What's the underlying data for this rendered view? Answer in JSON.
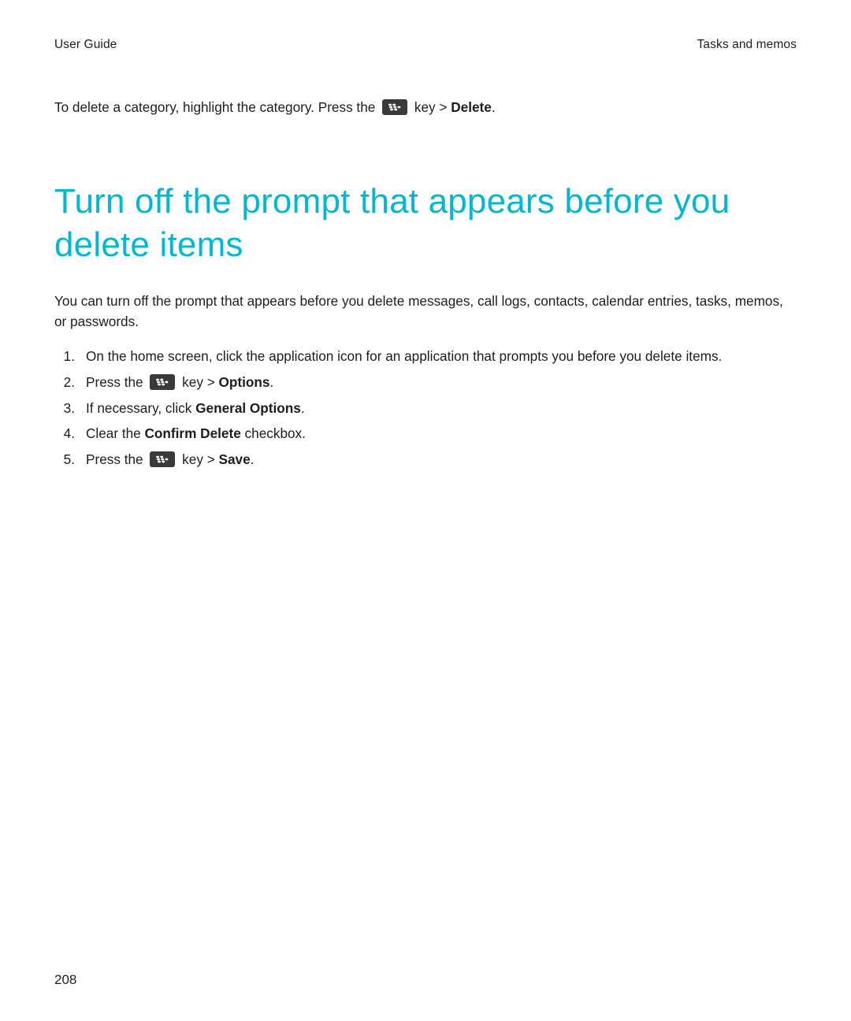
{
  "header": {
    "left": "User Guide",
    "right": "Tasks and memos"
  },
  "intro": {
    "prefix": "To delete a category, highlight the category. Press the ",
    "middle": " key > ",
    "bold": "Delete",
    "suffix": "."
  },
  "title": "Turn off the prompt that appears before you delete items",
  "body": "You can turn off the prompt that appears before you delete messages, call logs, contacts, calendar entries, tasks, memos, or passwords.",
  "steps": {
    "s1": {
      "text": "On the home screen, click the application icon for an application that prompts you before you delete items."
    },
    "s2": {
      "prefix": "Press the ",
      "middle": " key > ",
      "bold": "Options",
      "suffix": "."
    },
    "s3": {
      "prefix": "If necessary, click ",
      "bold": "General Options",
      "suffix": "."
    },
    "s4": {
      "prefix": "Clear the ",
      "bold": "Confirm Delete",
      "suffix": " checkbox."
    },
    "s5": {
      "prefix": "Press the ",
      "middle": " key > ",
      "bold": "Save",
      "suffix": "."
    }
  },
  "page_number": "208"
}
